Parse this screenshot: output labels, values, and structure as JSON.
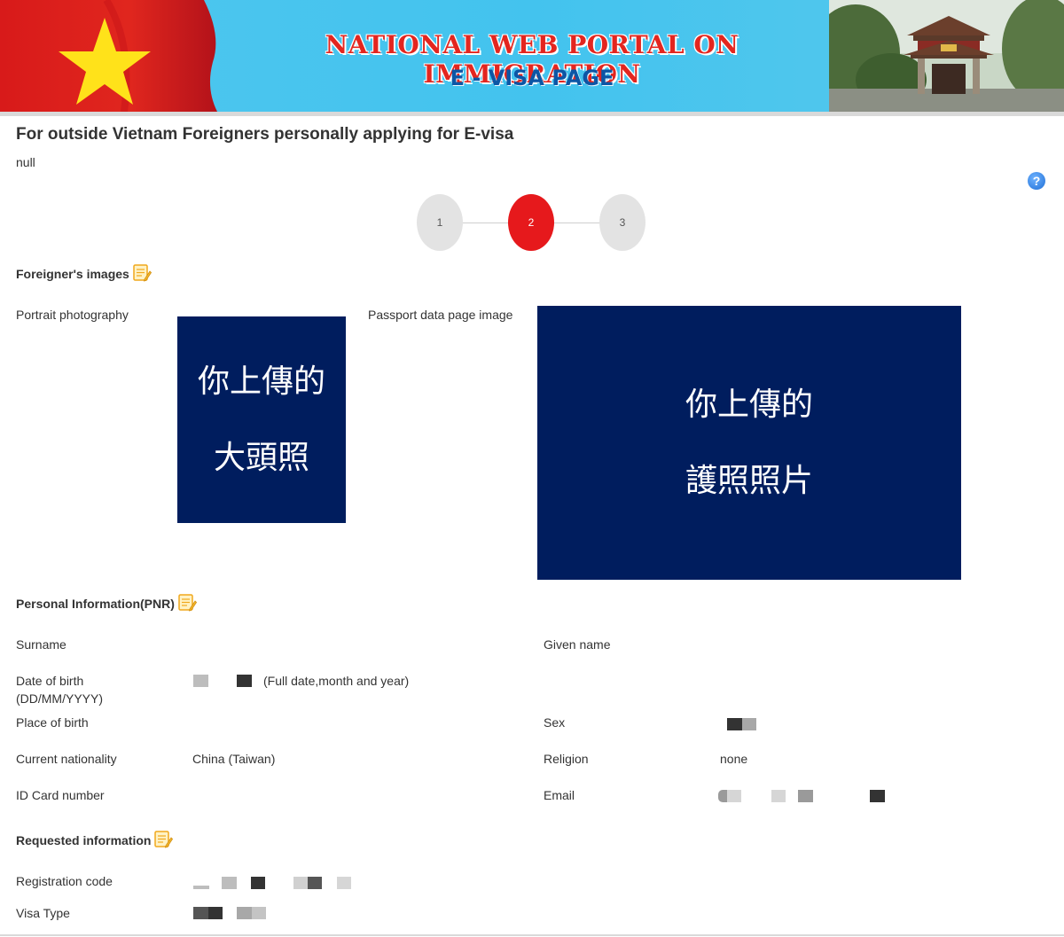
{
  "banner": {
    "title": "NATIONAL WEB PORTAL ON IMMIGRATION",
    "subtitle": "E - VISA PAGE"
  },
  "page": {
    "title": "For outside Vietnam Foreigners personally applying for E-visa",
    "null_text": "null",
    "help": "?"
  },
  "stepper": {
    "steps": [
      "1",
      "2",
      "3"
    ],
    "active": 2
  },
  "images_section": {
    "title": "Foreigner's images",
    "portrait_label": "Portrait photography",
    "portrait_line1": "你上傳的",
    "portrait_line2": "大頭照",
    "passport_label": "Passport data page image",
    "passport_line1": "你上傳的",
    "passport_line2": "護照照片"
  },
  "personal": {
    "title": "Personal Information(PNR)",
    "surname_label": "Surname",
    "given_name_label": "Given name",
    "dob_label_1": "Date of birth",
    "dob_label_2": "(DD/MM/YYYY)",
    "dob_hint": "(Full date,month and year)",
    "pob_label": "Place of birth",
    "sex_label": "Sex",
    "nationality_label": "Current nationality",
    "nationality_value": "China (Taiwan)",
    "religion_label": "Religion",
    "religion_value": "none",
    "id_label": "ID Card number",
    "email_label": "Email"
  },
  "requested": {
    "title": "Requested information",
    "reg_code_label": "Registration code",
    "visa_type_label": "Visa Type"
  },
  "colors": {
    "accent_red": "#e6191c",
    "upload_navy": "#001d5e"
  }
}
